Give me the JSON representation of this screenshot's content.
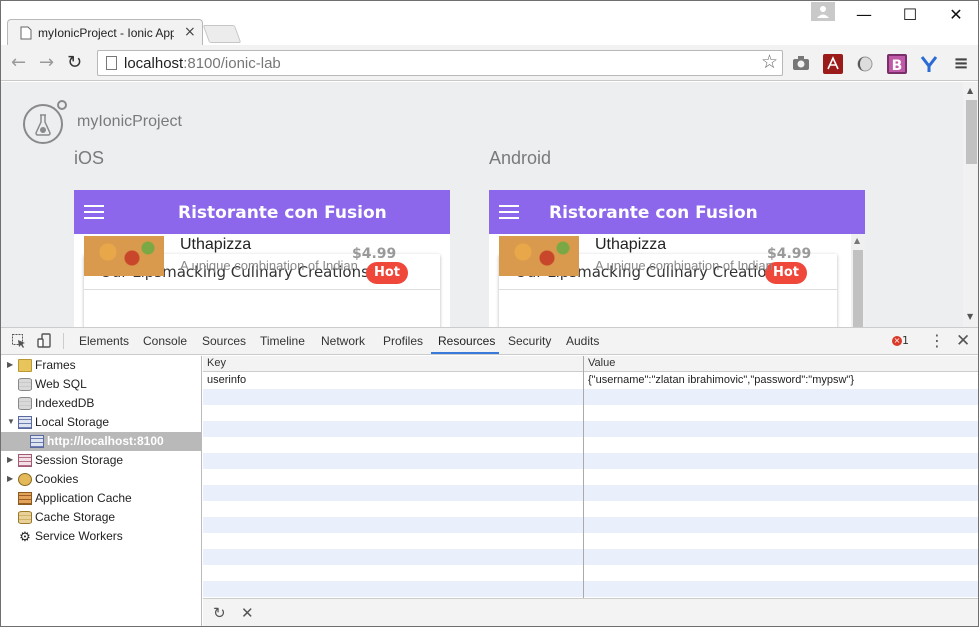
{
  "browser": {
    "tab_title": "myIonicProject - Ionic App",
    "tab_close": "×",
    "url_host": "localhost",
    "url_path": ":8100/ionic-lab",
    "window_minimize": "—",
    "window_maximize": "☐",
    "window_close": "✕",
    "back_icon": "←",
    "forward_icon": "→",
    "reload_icon": "↻",
    "star_icon": "☆",
    "menu_icon": "≡"
  },
  "page": {
    "app_name": "myIonicProject",
    "platforms": [
      {
        "name": "iOS",
        "bar_title": "Ristorante con Fusion",
        "card_header": "Our Lipsmacking Culinary Creations",
        "badge": "Hot",
        "dish_name": "Uthapizza",
        "dish_desc": "A unique combination of Indian",
        "price": "$4.99"
      },
      {
        "name": "Android",
        "bar_title": "Ristorante con Fusion",
        "card_header": "Our Lipsmacking Culinary Creations",
        "badge": "Hot",
        "dish_name": "Uthapizza",
        "dish_desc": "A unique combination of Indian",
        "price": "$4.99"
      }
    ],
    "colors": {
      "ionic_bar": "#8c66eb",
      "badge": "#ef473a"
    }
  },
  "devtools": {
    "tabs": [
      "Elements",
      "Console",
      "Sources",
      "Timeline",
      "Network",
      "Profiles",
      "Resources",
      "Security",
      "Audits"
    ],
    "active_tab": "Resources",
    "error_count": "1",
    "error_glyph": "×",
    "more_icon": "⋮",
    "close_icon": "✕",
    "sidebar": [
      {
        "label": "Frames",
        "icon": "folder-icon",
        "expandable": true
      },
      {
        "label": "Web SQL",
        "icon": "database-icon",
        "expandable": false
      },
      {
        "label": "IndexedDB",
        "icon": "database-icon",
        "expandable": false
      },
      {
        "label": "Local Storage",
        "icon": "storage-grid-icon",
        "expandable": true,
        "expanded": true
      },
      {
        "label": "http://localhost:8100",
        "icon": "storage-grid-icon",
        "child": true,
        "selected": true
      },
      {
        "label": "Session Storage",
        "icon": "session-storage-icon",
        "expandable": true
      },
      {
        "label": "Cookies",
        "icon": "cookie-icon",
        "expandable": true
      },
      {
        "label": "Application Cache",
        "icon": "app-cache-icon",
        "expandable": false
      },
      {
        "label": "Cache Storage",
        "icon": "cache-storage-icon",
        "expandable": false
      },
      {
        "label": "Service Workers",
        "icon": "gear-icon",
        "expandable": false
      }
    ],
    "storage_table": {
      "columns": [
        "Key",
        "Value"
      ],
      "rows": [
        {
          "key": "userinfo",
          "value": "{\"username\":\"zlatan ibrahimovic\",\"password\":\"mypsw\"}"
        }
      ]
    },
    "footer": {
      "refresh_icon": "↻",
      "delete_icon": "✕"
    }
  }
}
